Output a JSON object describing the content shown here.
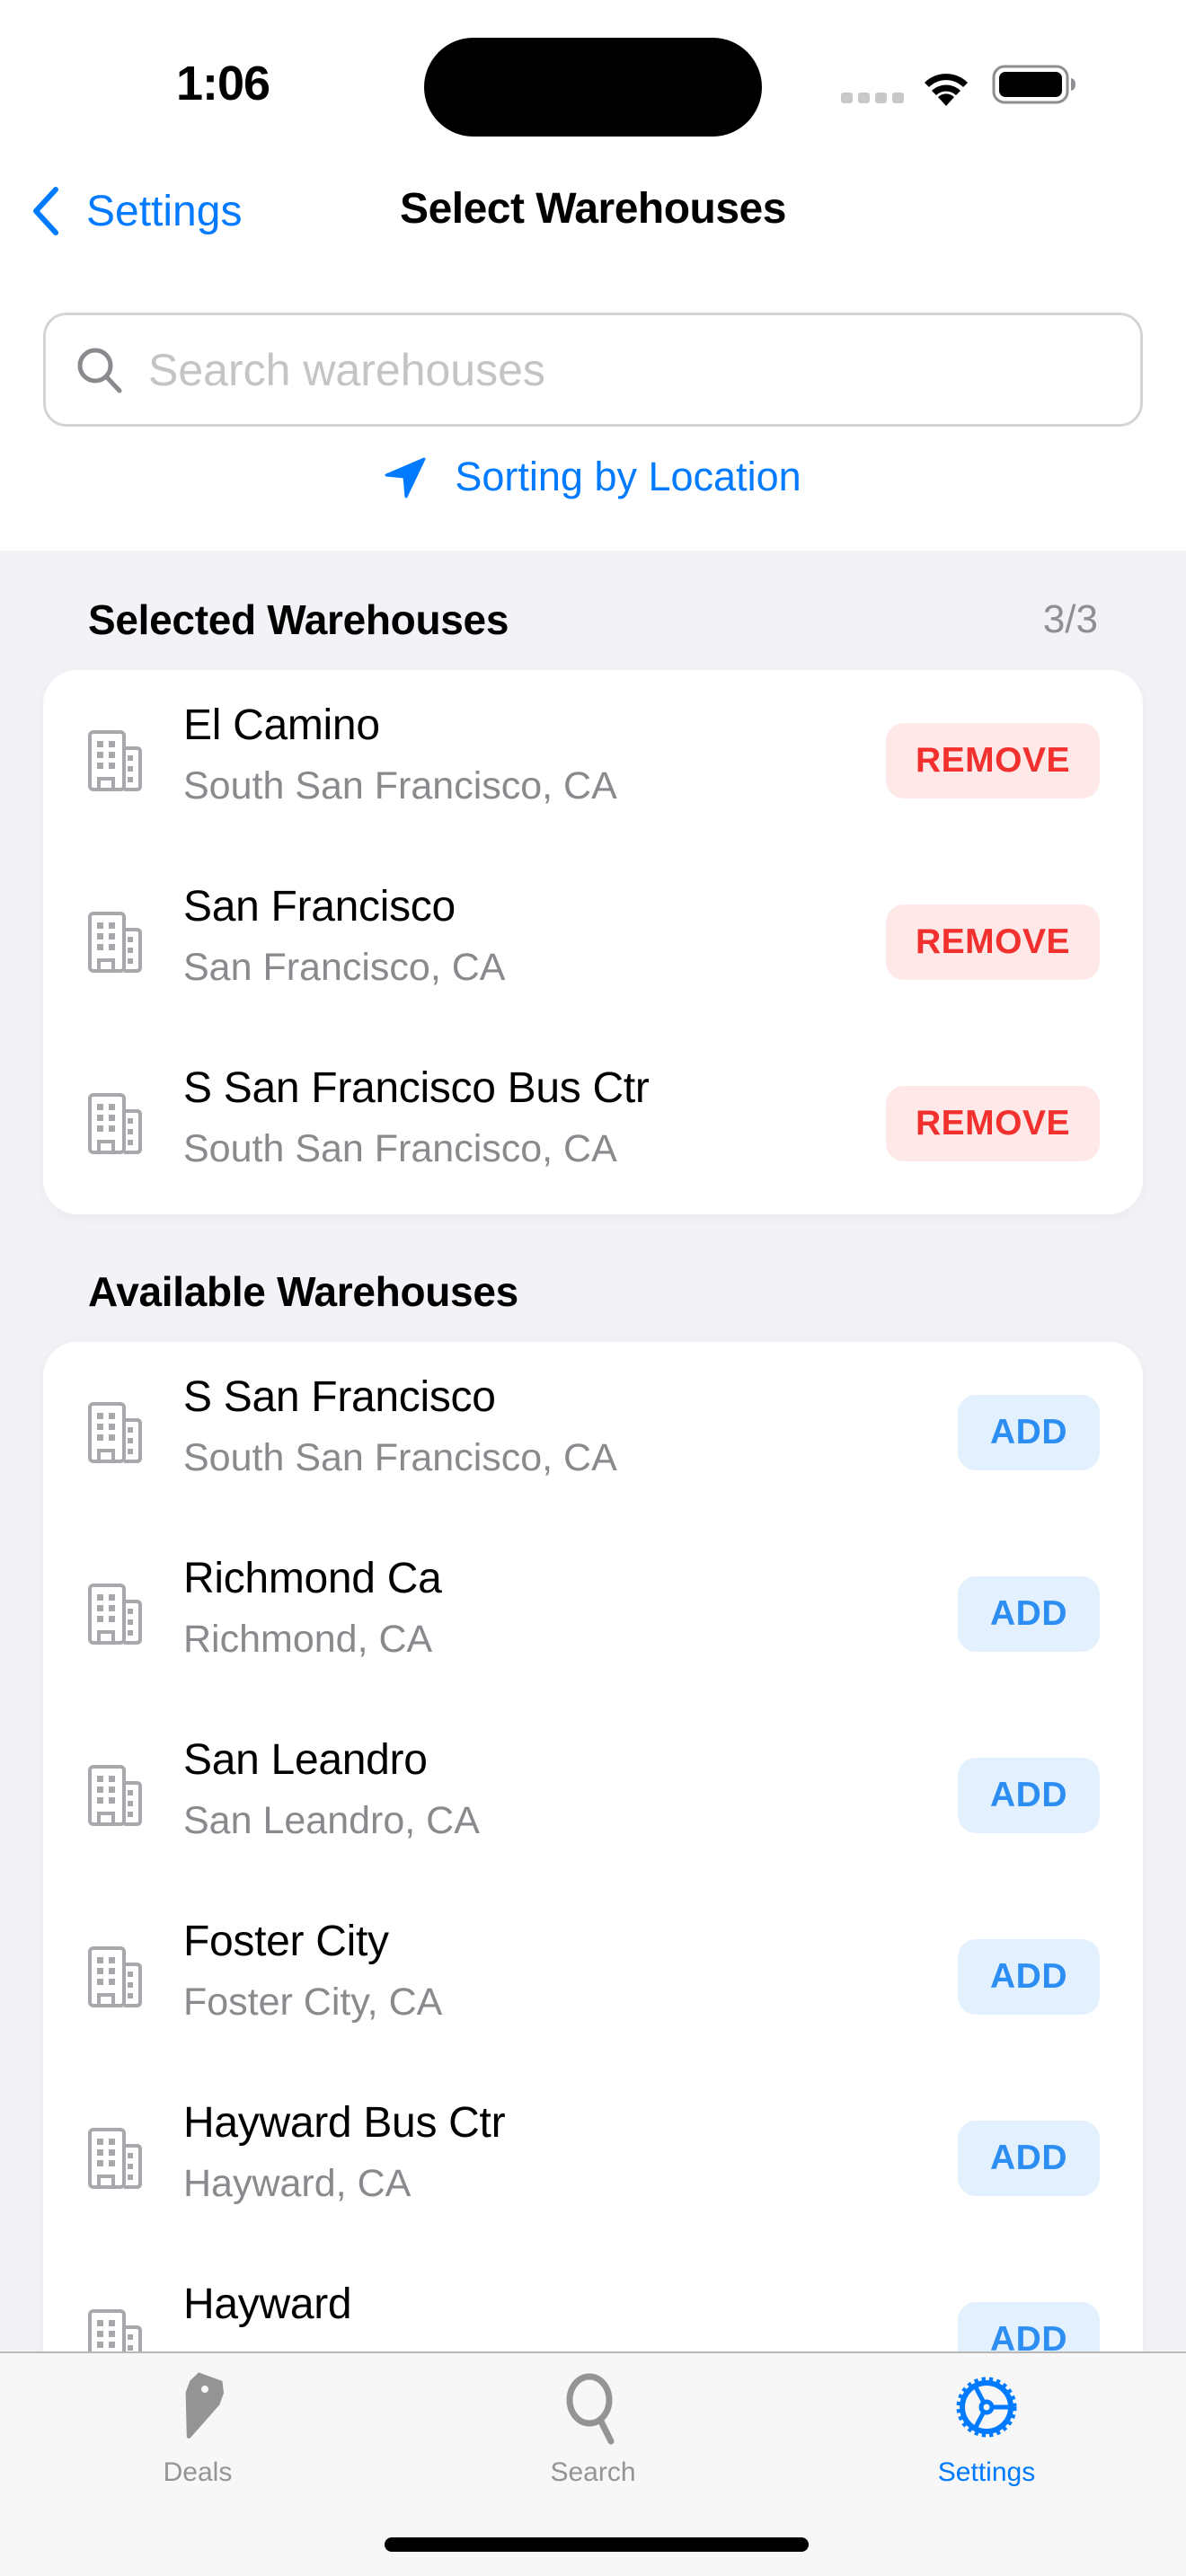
{
  "status_bar": {
    "time": "1:06",
    "icons": [
      "cellular-signal-icon",
      "wifi-icon",
      "battery-icon"
    ]
  },
  "nav": {
    "back_label": "Settings",
    "title": "Select Warehouses"
  },
  "search": {
    "placeholder": "Search warehouses",
    "value": ""
  },
  "sort": {
    "label": "Sorting by Location",
    "icon": "location-arrow-icon"
  },
  "selected": {
    "header": "Selected Warehouses",
    "count": "3/3",
    "button_label": "REMOVE",
    "items": [
      {
        "name": "El Camino",
        "location": "South San Francisco, CA"
      },
      {
        "name": "San Francisco",
        "location": "San Francisco, CA"
      },
      {
        "name": "S San Francisco Bus Ctr",
        "location": "South San Francisco, CA"
      }
    ]
  },
  "available": {
    "header": "Available Warehouses",
    "button_label": "ADD",
    "items": [
      {
        "name": "S San Francisco",
        "location": "South San Francisco, CA"
      },
      {
        "name": "Richmond Ca",
        "location": "Richmond, CA"
      },
      {
        "name": "San Leandro",
        "location": "San Leandro, CA"
      },
      {
        "name": "Foster City",
        "location": "Foster City, CA"
      },
      {
        "name": "Hayward Bus Ctr",
        "location": "Hayward, CA"
      },
      {
        "name": "Hayward",
        "location": ""
      }
    ]
  },
  "tabbar": {
    "tabs": [
      {
        "label": "Deals",
        "icon": "tag-icon",
        "active": false
      },
      {
        "label": "Search",
        "icon": "search-icon",
        "active": false
      },
      {
        "label": "Settings",
        "icon": "gear-icon",
        "active": true
      }
    ]
  },
  "colors": {
    "accent": "#007aff",
    "remove_text": "#f2302e",
    "remove_bg": "#ffe8e8",
    "add_text": "#2c8ef2",
    "add_bg": "#e3f0fe",
    "grouped_bg": "#f2f2f7",
    "secondary_text": "#8a8a8e"
  }
}
